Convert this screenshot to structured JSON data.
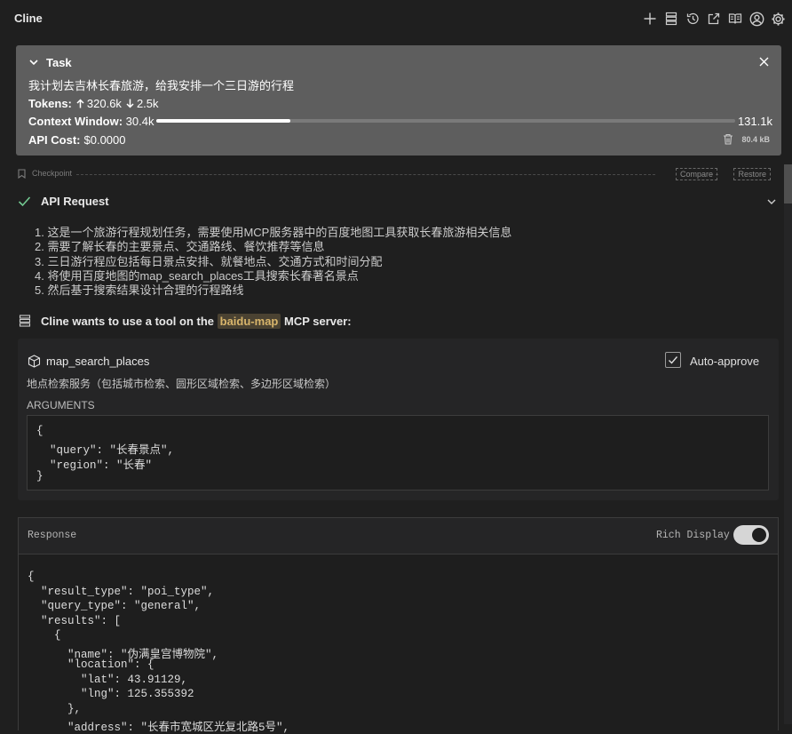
{
  "app": {
    "title": "Cline"
  },
  "toolbar": {
    "icons": [
      "plus-icon",
      "server-stack-icon",
      "history-icon",
      "external-link-icon",
      "book-icon",
      "account-icon",
      "gear-icon"
    ]
  },
  "task": {
    "label": "Task",
    "text": "我计划去吉林长春旅游，给我安排一个三日游的行程",
    "tokens_label": "Tokens:",
    "tokens_in": "320.6k",
    "tokens_out": "2.5k",
    "context_label": "Context Window:",
    "context_used": "30.4k",
    "context_max": "131.1k",
    "context_fraction": 0.232,
    "cost_label": "API Cost:",
    "cost_value": "$0.0000",
    "size": "80.4 kB"
  },
  "checkpoint": {
    "label": "Checkpoint",
    "compare": "Compare",
    "restore": "Restore"
  },
  "api_request": {
    "title": "API Request",
    "reasoning": [
      "1. 这是一个旅游行程规划任务，需要使用MCP服务器中的百度地图工具获取长春旅游相关信息",
      "2. 需要了解长春的主要景点、交通路线、餐饮推荐等信息",
      "3. 三日游行程应包括每日景点安排、就餐地点、交通方式和时间分配",
      "4. 将使用百度地图的map_search_places工具搜索长春著名景点",
      "5. 然后基于搜索结果设计合理的行程路线"
    ]
  },
  "tool": {
    "header_prefix": "Cline wants to use a tool on the",
    "server": "baidu-map",
    "header_suffix": "MCP server:",
    "name": "map_search_places",
    "auto_approve": "Auto-approve",
    "description": "地点检索服务（包括城市检索、圆形区域检索、多边形区域检索）",
    "arguments_label": "ARGUMENTS",
    "arguments_lines": [
      "{",
      "  \"query\": \"长春景点\",",
      "  \"region\": \"长春\"",
      "}"
    ]
  },
  "response": {
    "label": "Response",
    "rich_display": "Rich Display",
    "rich_display_on": true,
    "lines": [
      "{",
      "  \"result_type\": \"poi_type\",",
      "  \"query_type\": \"general\",",
      "  \"results\": [",
      "    {",
      "      \"name\": \"伪满皇宫博物院\",",
      "      \"location\": {",
      "        \"lat\": 43.91129,",
      "        \"lng\": 125.355392",
      "      },",
      "      \"address\": \"长春市宽城区光复北路5号\","
    ]
  }
}
